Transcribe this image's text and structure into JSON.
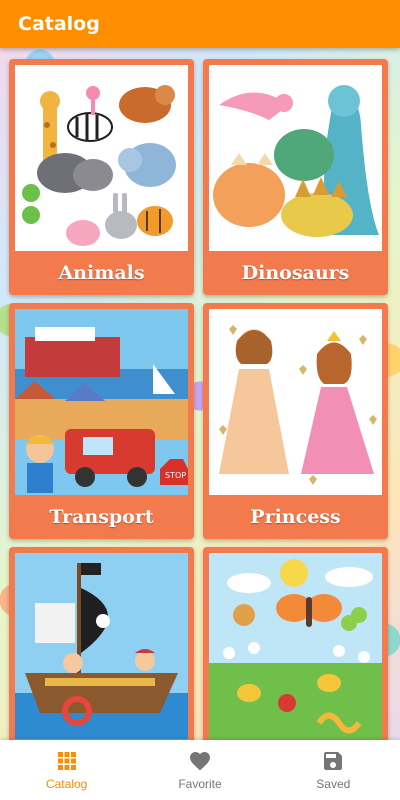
{
  "app_bar": {
    "title": "Catalog",
    "color": "#ff8d00"
  },
  "catalog": {
    "card_color": "#f27a4c",
    "items": [
      {
        "label": "Animals",
        "image": "animals-illustration"
      },
      {
        "label": "Dinosaurs",
        "image": "dinosaurs-illustration"
      },
      {
        "label": "Transport",
        "image": "transport-illustration"
      },
      {
        "label": "Princess",
        "image": "princess-illustration"
      },
      {
        "label": "",
        "image": "pirates-illustration"
      },
      {
        "label": "",
        "image": "insects-illustration"
      }
    ]
  },
  "bottom_nav": {
    "active_color": "#ff8d00",
    "items": [
      {
        "label": "Catalog",
        "icon": "grid-icon",
        "active": true
      },
      {
        "label": "Favorite",
        "icon": "heart-icon",
        "active": false
      },
      {
        "label": "Saved",
        "icon": "save-icon",
        "active": false
      }
    ]
  }
}
